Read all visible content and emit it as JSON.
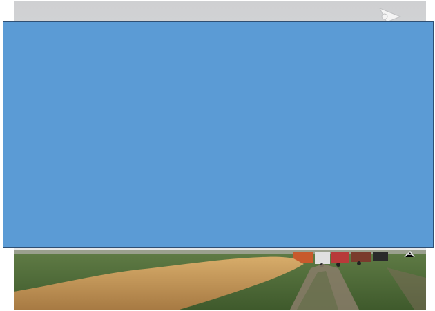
{
  "photo": {
    "subject": "field-with-turbine-and-trucks",
    "icon": "landscape-photo"
  },
  "overlay": {
    "fill_color": "#5b9bd5",
    "border_color": "#2f4f73"
  },
  "colors": {
    "sky": "#d8d9da",
    "grass": "#4f6b3a",
    "dry_grass": "#c79a5a",
    "dirt_track": "#8a7d6a"
  }
}
